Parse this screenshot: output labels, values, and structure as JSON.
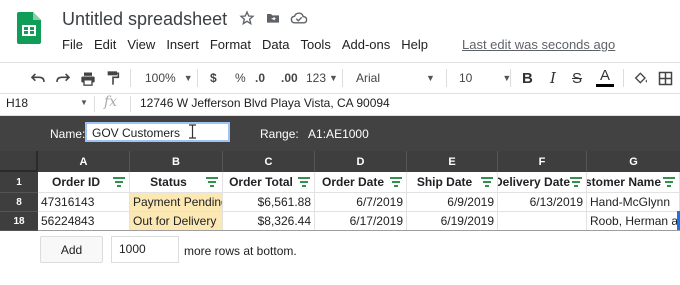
{
  "document": {
    "title": "Untitled spreadsheet",
    "last_edit": "Last edit was seconds ago",
    "menu": [
      "File",
      "Edit",
      "View",
      "Insert",
      "Format",
      "Data",
      "Tools",
      "Add-ons",
      "Help"
    ]
  },
  "toolbar": {
    "zoom": "100%",
    "currency": "$",
    "percent": "%",
    "decrease_decimal": ".0",
    "increase_decimal": ".00",
    "more_formats": "123",
    "font": "Arial",
    "font_size": "10",
    "bold": "B",
    "italic": "I",
    "strikethrough": "S",
    "text_color": "A"
  },
  "formula_bar": {
    "cell_ref": "H18",
    "fx": "fx",
    "content": "12746 W Jefferson Blvd Playa Vista, CA 90094"
  },
  "named_range": {
    "name_label": "Name:",
    "name_value": "GOV Customers",
    "range_label": "Range:",
    "range_value": "A1:AE1000"
  },
  "grid": {
    "columns": [
      "A",
      "B",
      "C",
      "D",
      "E",
      "F",
      "G"
    ],
    "headers": [
      "Order ID",
      "Status",
      "Order Total",
      "Order Date",
      "Ship Date",
      "Delivery Date",
      "Customer Name"
    ],
    "rows": [
      {
        "row_number": "1"
      },
      {
        "row_number": "8",
        "cells": [
          "47316143",
          "Payment Pending",
          "$6,561.88",
          "6/7/2019",
          "6/9/2019",
          "6/13/2019",
          "Hand-McGlynn"
        ]
      },
      {
        "row_number": "18",
        "cells": [
          "56224843",
          "Out for Delivery",
          "$8,326.44",
          "6/17/2019",
          "6/19/2019",
          "",
          "Roob, Herman and"
        ]
      }
    ]
  },
  "add_rows": {
    "button": "Add",
    "count": "1000",
    "suffix": "more rows at bottom."
  },
  "colors": {
    "sheets_green": "#0f9d58",
    "header_dark": "#3e3e3e",
    "filter_green": "#188038",
    "highlight_yellow": "#fce8b2"
  }
}
